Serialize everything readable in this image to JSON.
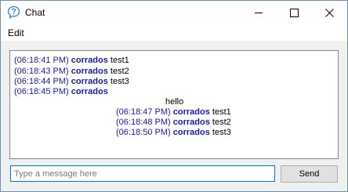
{
  "window": {
    "title": "Chat",
    "icon": "chat-bubble-icon"
  },
  "menu": {
    "items": [
      "Edit"
    ]
  },
  "chat": {
    "messages": [
      {
        "time": "(06:18:41 PM)",
        "user": "corrados",
        "text": "test1"
      },
      {
        "time": "(06:18:43 PM)",
        "user": "corrados",
        "text": "test2"
      },
      {
        "time": "(06:18:44 PM)",
        "user": "corrados",
        "text": "test3"
      },
      {
        "time": "(06:18:45 PM)",
        "user": "corrados",
        "text": ""
      },
      {
        "plain": "hello"
      },
      {
        "time": "(06:18:47 PM)",
        "user": "corrados",
        "text": "test1"
      },
      {
        "time": "(06:18:48 PM)",
        "user": "corrados",
        "text": "test2"
      },
      {
        "time": "(06:18:50 PM)",
        "user": "corrados",
        "text": "test3"
      }
    ]
  },
  "input": {
    "placeholder": "Type a message here",
    "value": ""
  },
  "send": {
    "label": "Send"
  },
  "colors": {
    "timestamp": "#1a1aaa",
    "username": "#1a1aaa",
    "input_focus": "#0078d7"
  }
}
